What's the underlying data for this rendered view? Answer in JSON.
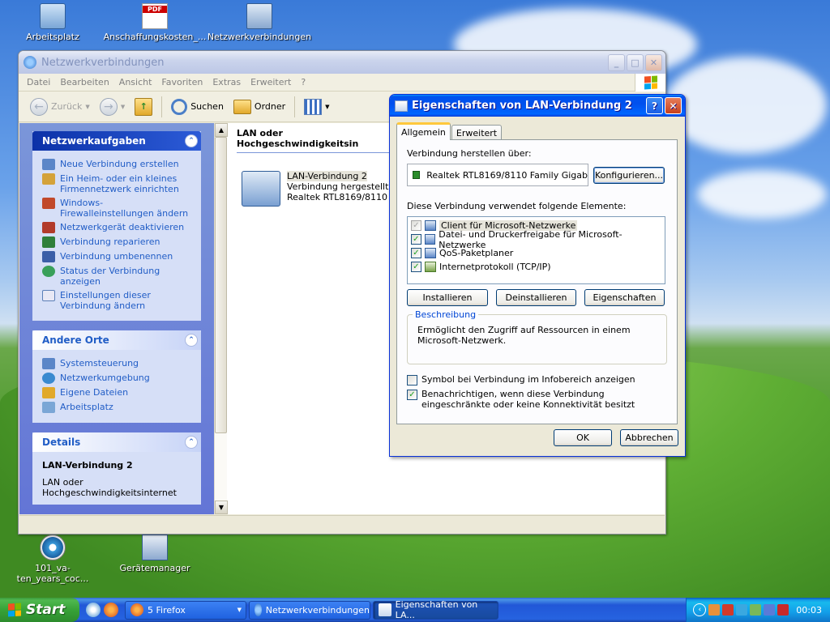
{
  "desktop": {
    "icons": [
      {
        "label": "Arbeitsplatz",
        "icon": "my-computer-icon"
      },
      {
        "label": "Anschaffungskosten_...",
        "icon": "pdf-document-icon"
      },
      {
        "label": "Netzwerkverbindungen",
        "icon": "network-connections-icon"
      },
      {
        "label": "101_va-ten_years_coc...",
        "icon": "media-file-icon"
      },
      {
        "label": "Gerätemanager",
        "icon": "device-manager-icon"
      }
    ]
  },
  "explorer": {
    "title": "Netzwerkverbindungen",
    "menu": [
      "Datei",
      "Bearbeiten",
      "Ansicht",
      "Favoriten",
      "Extras",
      "Erweitert",
      "?"
    ],
    "toolbar": {
      "back": "Zurück",
      "search": "Suchen",
      "folders": "Ordner"
    },
    "tasks": {
      "title": "Netzwerkaufgaben",
      "items": [
        "Neue Verbindung erstellen",
        "Ein Heim- oder ein kleines Firmennetzwerk einrichten",
        "Windows-Firewalleinstellungen ändern",
        "Netzwerkgerät deaktivieren",
        "Verbindung reparieren",
        "Verbindung umbenennen",
        "Status der Verbindung anzeigen",
        "Einstellungen dieser Verbindung ändern"
      ]
    },
    "other_places": {
      "title": "Andere Orte",
      "items": [
        "Systemsteuerung",
        "Netzwerkumgebung",
        "Eigene Dateien",
        "Arbeitsplatz"
      ]
    },
    "details": {
      "title": "Details",
      "name": "LAN-Verbindung 2",
      "desc": "LAN oder Hochgeschwindigkeitsinternet"
    },
    "group_header": "LAN oder Hochgeschwindigkeitsin",
    "connection": {
      "name": "LAN-Verbindung 2",
      "status": "Verbindung hergestellt",
      "device": "Realtek RTL8169/8110 Fami"
    }
  },
  "dialog": {
    "title": "Eigenschaften von LAN-Verbindung 2",
    "tabs": [
      "Allgemein",
      "Erweitert"
    ],
    "connect_using_label": "Verbindung herstellen über:",
    "adapter": "Realtek RTL8169/8110 Family Gigab",
    "configure": "Konfigurieren...",
    "elements_label": "Diese Verbindung verwendet folgende Elemente:",
    "elements": [
      {
        "label": "Client für Microsoft-Netzwerke",
        "checked": true
      },
      {
        "label": "Datei- und Druckerfreigabe für Microsoft-Netzwerke",
        "checked": true
      },
      {
        "label": "QoS-Paketplaner",
        "checked": true
      },
      {
        "label": "Internetprotokoll (TCP/IP)",
        "checked": true
      }
    ],
    "install": "Installieren",
    "uninstall": "Deinstallieren",
    "properties": "Eigenschaften",
    "description_legend": "Beschreibung",
    "description": "Ermöglicht den Zugriff auf Ressourcen in einem Microsoft-Netzwerk.",
    "show_icon": {
      "label": "Symbol bei Verbindung im Infobereich anzeigen",
      "checked": false
    },
    "notify": {
      "label": "Benachrichtigen, wenn diese Verbindung eingeschränkte oder keine Konnektivität besitzt",
      "checked": true
    },
    "ok": "OK",
    "cancel": "Abbrechen"
  },
  "taskbar": {
    "start": "Start",
    "items": [
      {
        "label": "5 Firefox",
        "active": false
      },
      {
        "label": "Netzwerkverbindungen",
        "active": false
      },
      {
        "label": "Eigenschaften von LA...",
        "active": true
      }
    ],
    "clock": "00:03"
  }
}
